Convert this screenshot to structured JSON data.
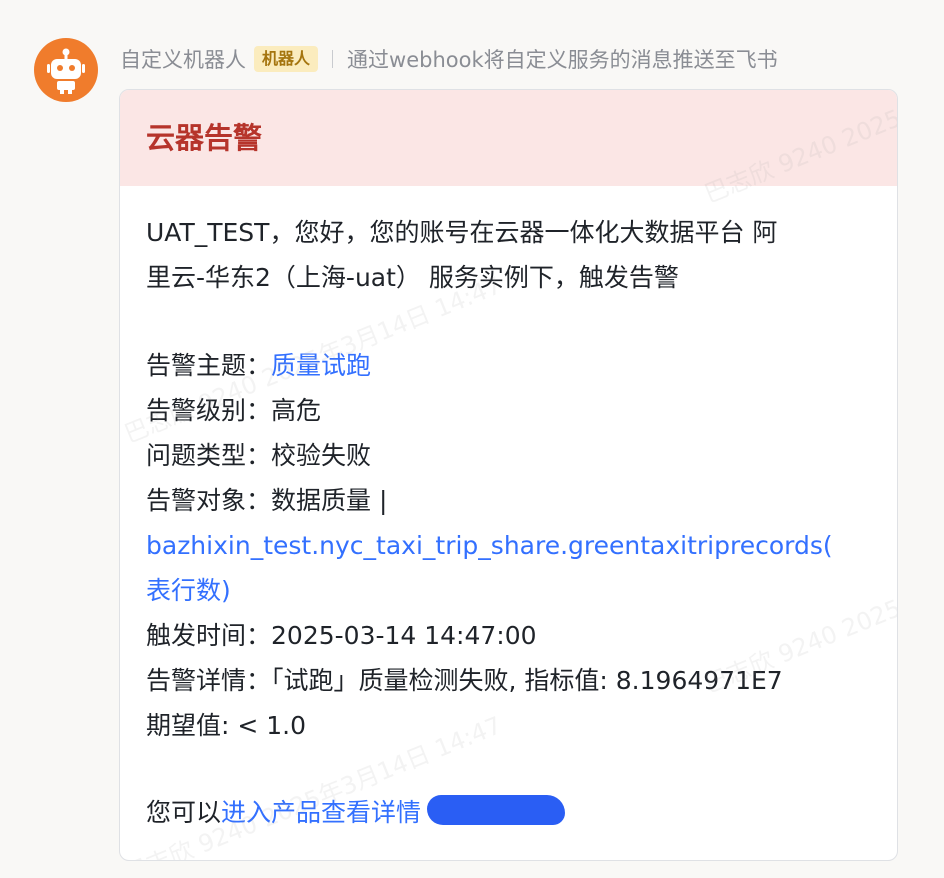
{
  "sender": {
    "name": "自定义机器人",
    "tag": "机器人",
    "description": "通过webhook将自定义服务的消息推送至飞书"
  },
  "card": {
    "title": "云器告警",
    "intro_line1": "UAT_TEST，您好，您的账号在云器一体化大数据平台 阿",
    "intro_line2": "里云-华东2（上海-uat） 服务实例下，触发告警",
    "fields": {
      "topic_label": "告警主题：",
      "topic_value": "质量试跑",
      "level_label": "告警级别：",
      "level_value": "高危",
      "problem_label": "问题类型：",
      "problem_value": "校验失败",
      "object_label": "告警对象：",
      "object_value": "数据质量 |",
      "object_link_line1": "bazhixin_test.nyc_taxi_trip_share.greentaxitriprecords(",
      "object_link_line2": "表行数)",
      "time_label": "触发时间：",
      "time_value": "2025-03-14 14:47:00",
      "detail_label": "告警详情：",
      "detail_value": "「试跑」质量检测失败, 指标值: 8.1964971E7",
      "expected_line": "期望值: < 1.0"
    },
    "footer_prefix": "您可以",
    "footer_link": "进入产品查看详情"
  },
  "watermark_text": "巴志欣 9240 2025年3月14日 14:47",
  "colors": {
    "avatar_bg": "#f07c2c",
    "header_bg": "#fbe6e5",
    "title": "#b6342b",
    "link": "#3370ff",
    "tag_bg": "#fbecbe",
    "tag_text": "#a5750f"
  },
  "icons": {
    "avatar": "robot-icon"
  }
}
